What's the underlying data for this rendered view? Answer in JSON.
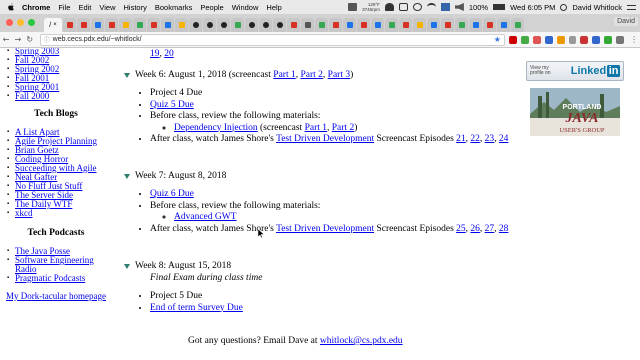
{
  "menubar": {
    "app": "Chrome",
    "items": [
      "File",
      "Edit",
      "View",
      "History",
      "Bookmarks",
      "People",
      "Window",
      "Help"
    ],
    "status_top": "129°F",
    "status_bottom": "3746rpm",
    "battery": "100%",
    "datetime": "Wed 6:05 PM",
    "user": "David Whitlock"
  },
  "tabs": {
    "active_label": "/",
    "profile": "David"
  },
  "toolbar": {
    "info_icon": "ⓘ",
    "url": "web.cecs.pdx.edu/~whitlock/"
  },
  "sidebar": {
    "semesters": [
      "Spring 2003",
      "Fall 2002",
      "Spring 2002",
      "Fall 2001",
      "Spring 2001",
      "Fall 2000"
    ],
    "blogs_heading": "Tech Blogs",
    "blogs": [
      "A List Apart",
      "Agile Project Planning",
      "Brian Goetz",
      "Coding Horror",
      "Succeeding with Agile",
      "Neal Gafter",
      "No Fluff Just Stuff",
      "The Server Side",
      "The Daily WTF",
      "xkcd"
    ],
    "podcasts_heading": "Tech Podcasts",
    "podcasts": [
      "The Java Posse",
      "Software Engineering Radio",
      "Pragmatic Podcasts"
    ],
    "homepage_link": "My Dork-tacular homepage"
  },
  "main": {
    "prev_links": [
      "19",
      "20"
    ],
    "week6": {
      "title": "Week 6: August 1, 2018 (screencast",
      "parts": [
        "Part 1",
        "Part 2",
        "Part 3"
      ],
      "item1": "Project 4 Due",
      "item2_link": "Quiz 5 Due",
      "item3": "Before class, review the following materials:",
      "sub_link": "Dependency Injection",
      "sub_text": "(screencast",
      "sub_parts": [
        "Part 1",
        "Part 2"
      ],
      "item4_pre": "After class, watch James Shore's",
      "item4_link": "Test Driven Development",
      "item4_post": "Screencast Episodes",
      "episodes": [
        "21",
        "22",
        "23",
        "24"
      ]
    },
    "week7": {
      "title": "Week 7: August 8, 2018",
      "item1_link": "Quiz 6 Due",
      "item2": "Before class, review the following materials:",
      "sub_link": "Advanced GWT",
      "item3_pre": "After class, watch James Shore's",
      "item3_link": "Test Driven Development",
      "item3_post": "Screencast Episodes",
      "episodes": [
        "25",
        "26",
        "27",
        "28"
      ]
    },
    "week8": {
      "title": "Week 8: August 15, 2018",
      "exam": "Final Exam during class time",
      "item1": "Project 5 Due",
      "item2_link": "End of term Survey Due"
    }
  },
  "badges": {
    "linkedin_small1": "View my",
    "linkedin_small2": "profile on",
    "linkedin_brand": "Linked",
    "linkedin_in": "in",
    "pjug_line1": "PORTLAND",
    "pjug_line2": "JAVA",
    "pjug_line3": "USER'S GROUP"
  },
  "footer": {
    "text": "Got any questions? Email Dave at",
    "email": "whitlock@cs.pdx.edu"
  },
  "colors": {
    "link": "#0000ee",
    "triangle": "#2e7d6f",
    "linkedin_blue": "#0e76a8"
  }
}
